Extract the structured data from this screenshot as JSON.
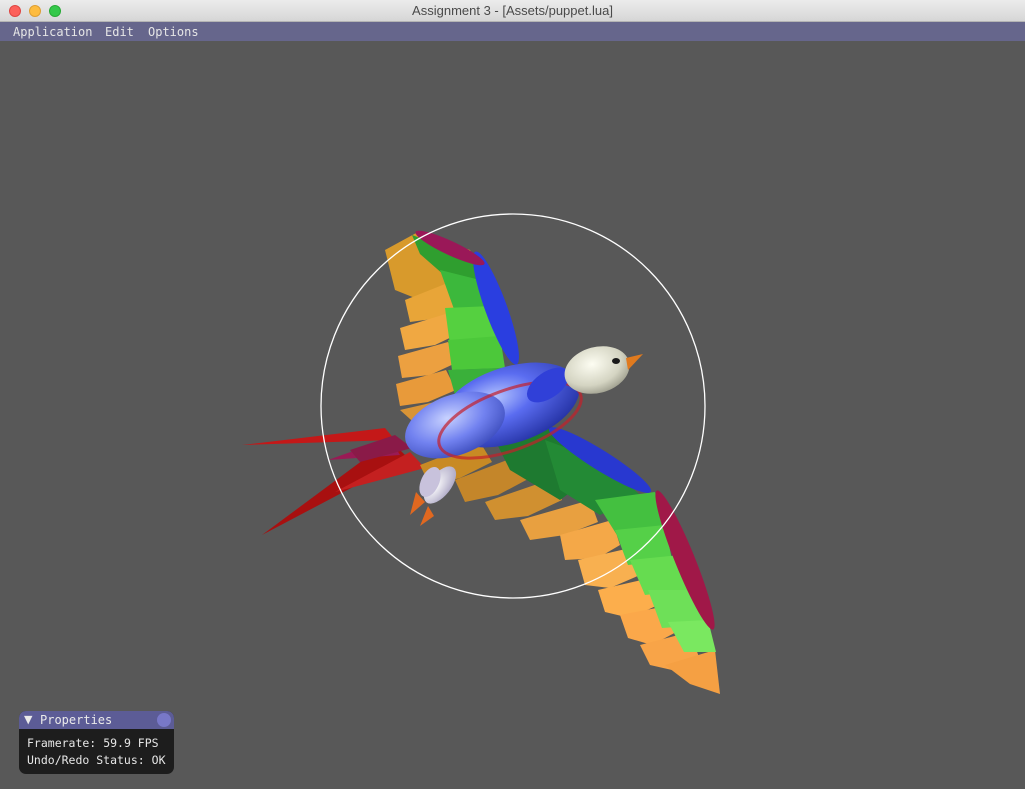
{
  "window": {
    "title": "Assignment 3 - [Assets/puppet.lua]"
  },
  "menu": {
    "application": "Application",
    "edit": "Edit",
    "options": "Options"
  },
  "properties": {
    "title": "Properties",
    "framerate_label": "Framerate:",
    "framerate_value": "59.9 FPS",
    "undo_label": "Undo/Redo Status:",
    "undo_value": "OK"
  },
  "colors": {
    "background": "#585858",
    "menubar": "#66668c",
    "panel_header": "#5c5c96"
  },
  "icons": {
    "collapse": "triangle-down-icon",
    "trackball": "trackball-circle"
  }
}
